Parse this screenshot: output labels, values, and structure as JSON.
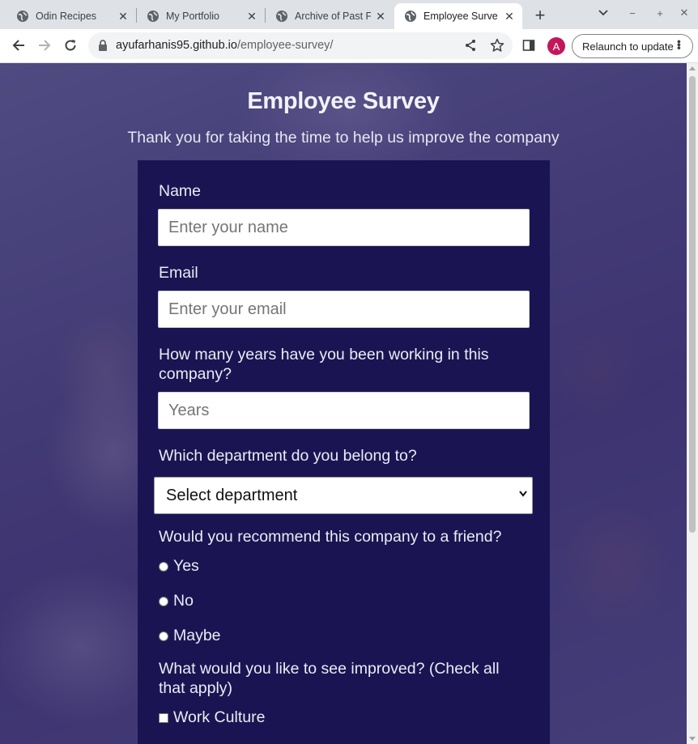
{
  "browser": {
    "tabs": [
      {
        "title": "Odin Recipes",
        "active": false
      },
      {
        "title": "My Portfolio",
        "active": false
      },
      {
        "title": "Archive of Past F",
        "active": false
      },
      {
        "title": "Employee Surve",
        "active": true
      }
    ],
    "new_tab_icon": "plus-icon",
    "url_host": "ayufarhanis95.github.io",
    "url_path": "/employee-survey/",
    "profile_initial": "A",
    "relaunch_label": "Relaunch to update"
  },
  "page": {
    "title": "Employee Survey",
    "description": "Thank you for taking the time to help us improve the company",
    "form": {
      "name_label": "Name",
      "name_placeholder": "Enter your name",
      "email_label": "Email",
      "email_placeholder": "Enter your email",
      "years_label": "How many years have you been working in this company?",
      "years_placeholder": "Years",
      "department_label": "Which department do you belong to?",
      "department_selected": "Select department",
      "recommend_label": "Would you recommend this company to a friend?",
      "recommend_options": [
        "Yes",
        "No",
        "Maybe"
      ],
      "improve_label": "What would you like to see improved? (Check all that apply)",
      "improve_options": [
        "Work Culture"
      ]
    }
  },
  "colors": {
    "form_background": "#1a1552",
    "overlay": "#362c78",
    "profile_avatar": "#c2185b"
  }
}
